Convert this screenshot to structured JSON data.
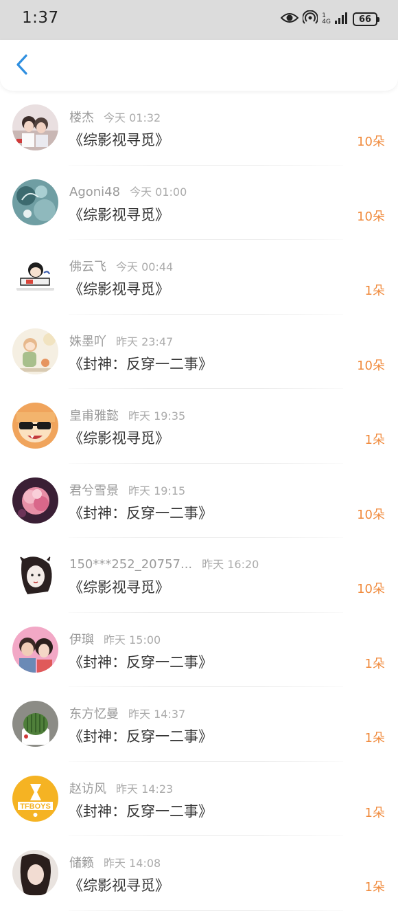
{
  "status": {
    "time": "1:37",
    "battery": "66",
    "network": "4G",
    "sim": "1",
    "icons": [
      "eye-icon",
      "hotspot-icon",
      "signal-icon",
      "battery-icon"
    ]
  },
  "header": {
    "back_icon": "chevron-left-icon",
    "accent": "#2f8fe0"
  },
  "colors": {
    "amount": "#f08a3c"
  },
  "items": [
    {
      "name": "楼杰",
      "time": "今天 01:32",
      "book": "《综影视寻觅》",
      "amount": "10朵"
    },
    {
      "name": "Agoni48",
      "time": "今天 01:00",
      "book": "《综影视寻觅》",
      "amount": "10朵"
    },
    {
      "name": "佛云飞",
      "time": "今天 00:44",
      "book": "《综影视寻觅》",
      "amount": "1朵"
    },
    {
      "name": "姝墨吖",
      "time": "昨天 23:47",
      "book": "《封神：反穿一二事》",
      "amount": "10朵"
    },
    {
      "name": "皇甫雅懿",
      "time": "昨天 19:35",
      "book": "《综影视寻觅》",
      "amount": "1朵"
    },
    {
      "name": "君兮雪景",
      "time": "昨天 19:15",
      "book": "《封神：反穿一二事》",
      "amount": "10朵"
    },
    {
      "name": "150***252_20757...",
      "time": "昨天 16:20",
      "book": "《综影视寻觅》",
      "amount": "10朵"
    },
    {
      "name": "伊璵",
      "time": "昨天 15:00",
      "book": "《封神：反穿一二事》",
      "amount": "1朵"
    },
    {
      "name": "东方忆曼",
      "time": "昨天 14:37",
      "book": "《封神：反穿一二事》",
      "amount": "1朵"
    },
    {
      "name": "赵访风",
      "time": "昨天 14:23",
      "book": "《封神：反穿一二事》",
      "amount": "1朵"
    },
    {
      "name": "储籁",
      "time": "昨天 14:08",
      "book": "《综影视寻觅》",
      "amount": "1朵"
    }
  ]
}
